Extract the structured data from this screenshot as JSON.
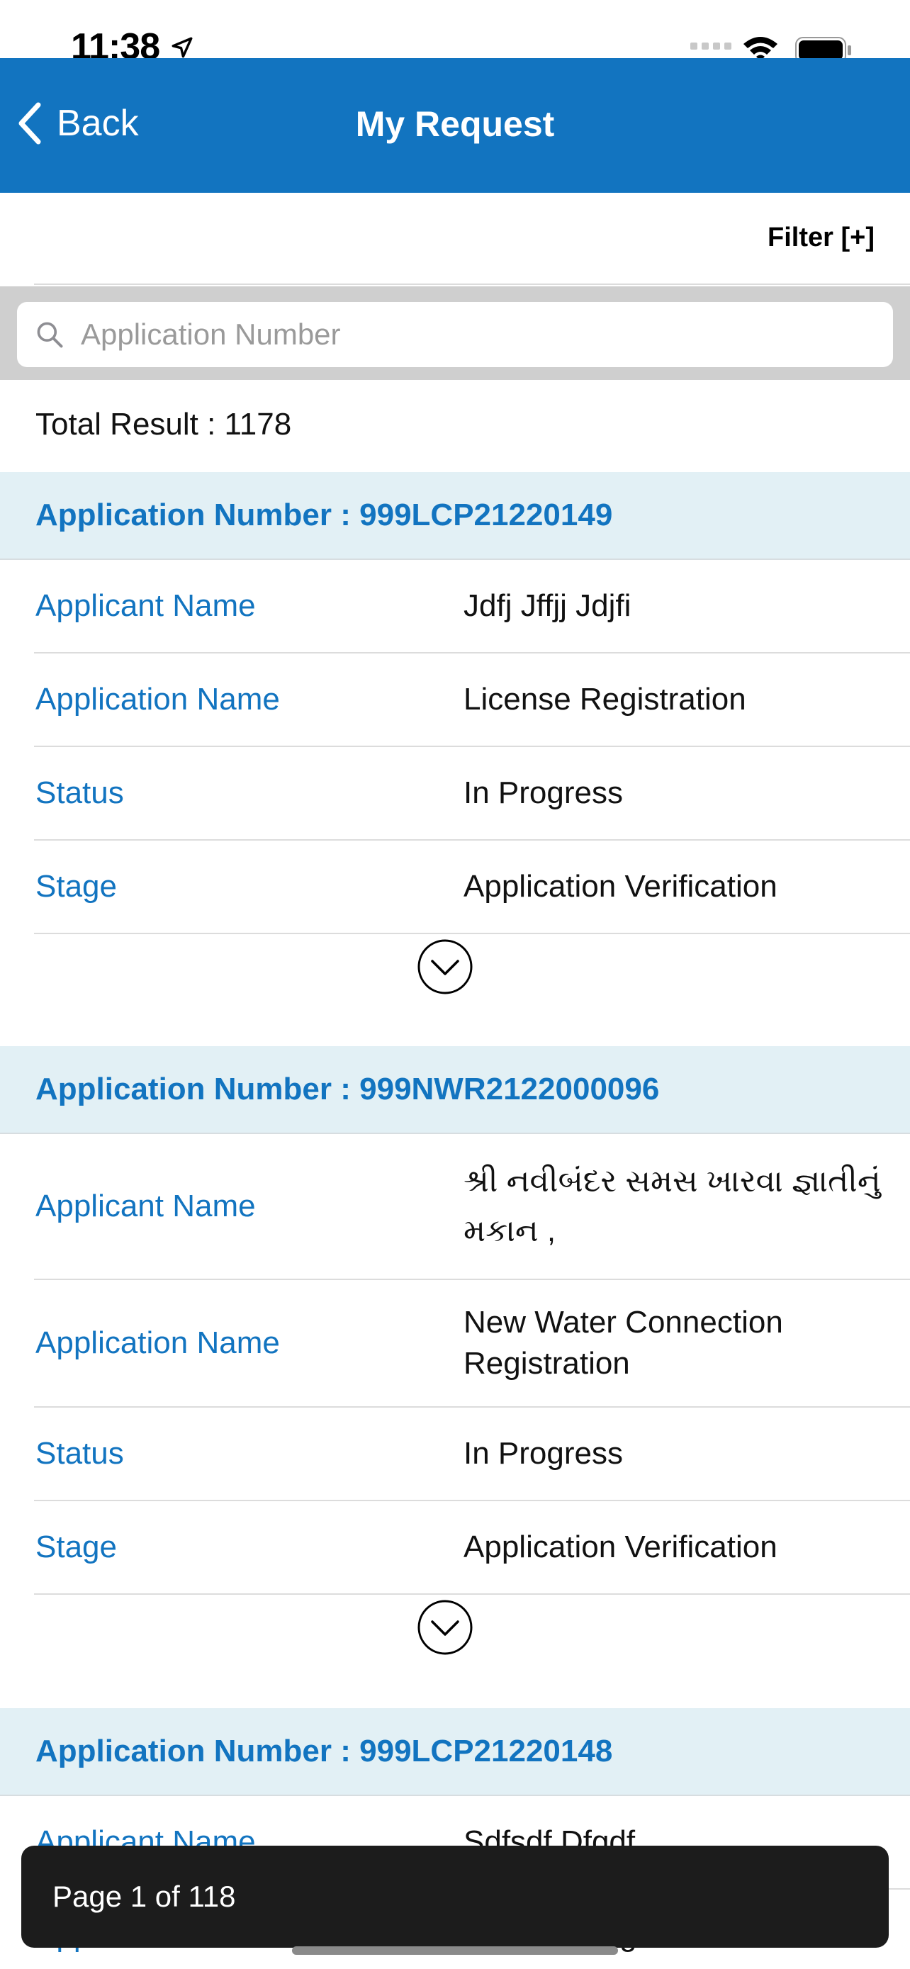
{
  "status_bar": {
    "time": "11:38"
  },
  "nav": {
    "back_label": "Back",
    "title": "My Request"
  },
  "filter": {
    "label": "Filter [+]"
  },
  "search": {
    "placeholder": "Application Number",
    "value": ""
  },
  "total_result": "Total Result : 1178",
  "labels": {
    "applicant_name": "Applicant Name",
    "application_name": "Application Name",
    "status": "Status",
    "stage": "Stage"
  },
  "applications": [
    {
      "header": "Application Number : 999LCP21220149",
      "applicant_name": "Jdfj Jffjj Jdjfi",
      "application_name": "License Registration",
      "status": "In Progress",
      "stage": "Application Verification"
    },
    {
      "header": "Application Number : 999NWR2122000096",
      "applicant_name": "શ્રી નવીબંદર સમસ ખારવા જ્ઞાતીનું મકાન ,",
      "application_name": "New Water Connection Registration",
      "status": "In Progress",
      "stage": "Application Verification"
    },
    {
      "header": "Application Number : 999LCP21220148",
      "applicant_name": "Sdfsdf Dfgdf",
      "application_name": "License Registration"
    }
  ],
  "pagination": {
    "text": "Page 1 of 118"
  },
  "colors": {
    "primary": "#1274c0",
    "card_header_bg": "#e2f0f5",
    "toast_bg": "#1c1c1c"
  }
}
